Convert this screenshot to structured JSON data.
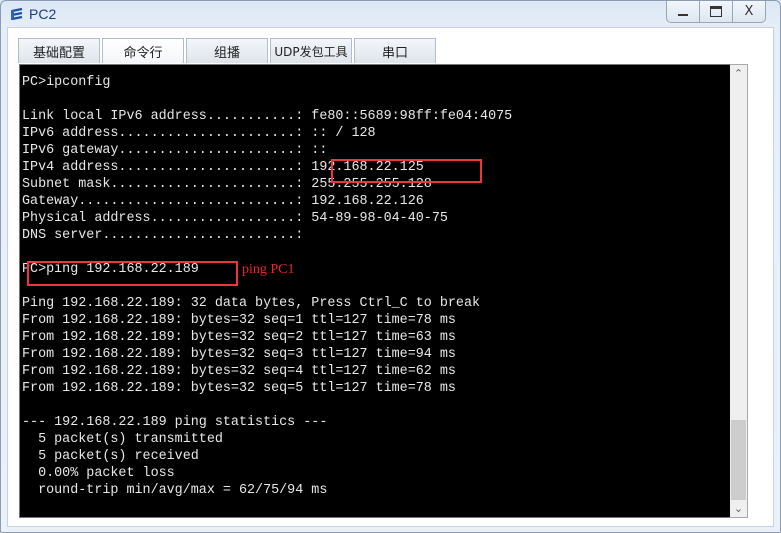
{
  "window": {
    "title": "PC2",
    "icon": "network-pc-icon",
    "controls": {
      "minimize": "minimize-icon",
      "maximize": "maximize-icon",
      "close": "close-icon"
    }
  },
  "tabs": [
    {
      "label": "基础配置",
      "active": false
    },
    {
      "label": "命令行",
      "active": true
    },
    {
      "label": "组播",
      "active": false
    },
    {
      "label": "UDP发包工具",
      "active": false
    },
    {
      "label": "串口",
      "active": false
    }
  ],
  "terminal": {
    "lines": [
      "PC>ipconfig",
      "",
      "Link local IPv6 address...........: fe80::5689:98ff:fe04:4075",
      "IPv6 address......................: :: / 128",
      "IPv6 gateway......................: ::",
      "IPv4 address......................: 192.168.22.125",
      "Subnet mask.......................: 255.255.255.128",
      "Gateway...........................: 192.168.22.126",
      "Physical address..................: 54-89-98-04-40-75",
      "DNS server........................:",
      "",
      "PC>ping 192.168.22.189",
      "",
      "Ping 192.168.22.189: 32 data bytes, Press Ctrl_C to break",
      "From 192.168.22.189: bytes=32 seq=1 ttl=127 time=78 ms",
      "From 192.168.22.189: bytes=32 seq=2 ttl=127 time=63 ms",
      "From 192.168.22.189: bytes=32 seq=3 ttl=127 time=94 ms",
      "From 192.168.22.189: bytes=32 seq=4 ttl=127 time=62 ms",
      "From 192.168.22.189: bytes=32 seq=5 ttl=127 time=78 ms",
      "",
      "--- 192.168.22.189 ping statistics ---",
      "  5 packet(s) transmitted",
      "  5 packet(s) received",
      "  0.00% packet loss",
      "  round-trip min/avg/max = 62/75/94 ms"
    ]
  },
  "annotations": {
    "ping_label": "ping PC1",
    "highlight_color": "#f0353a"
  },
  "scrollbar": {
    "up": "chevron-up-icon",
    "down": "chevron-down-icon"
  }
}
